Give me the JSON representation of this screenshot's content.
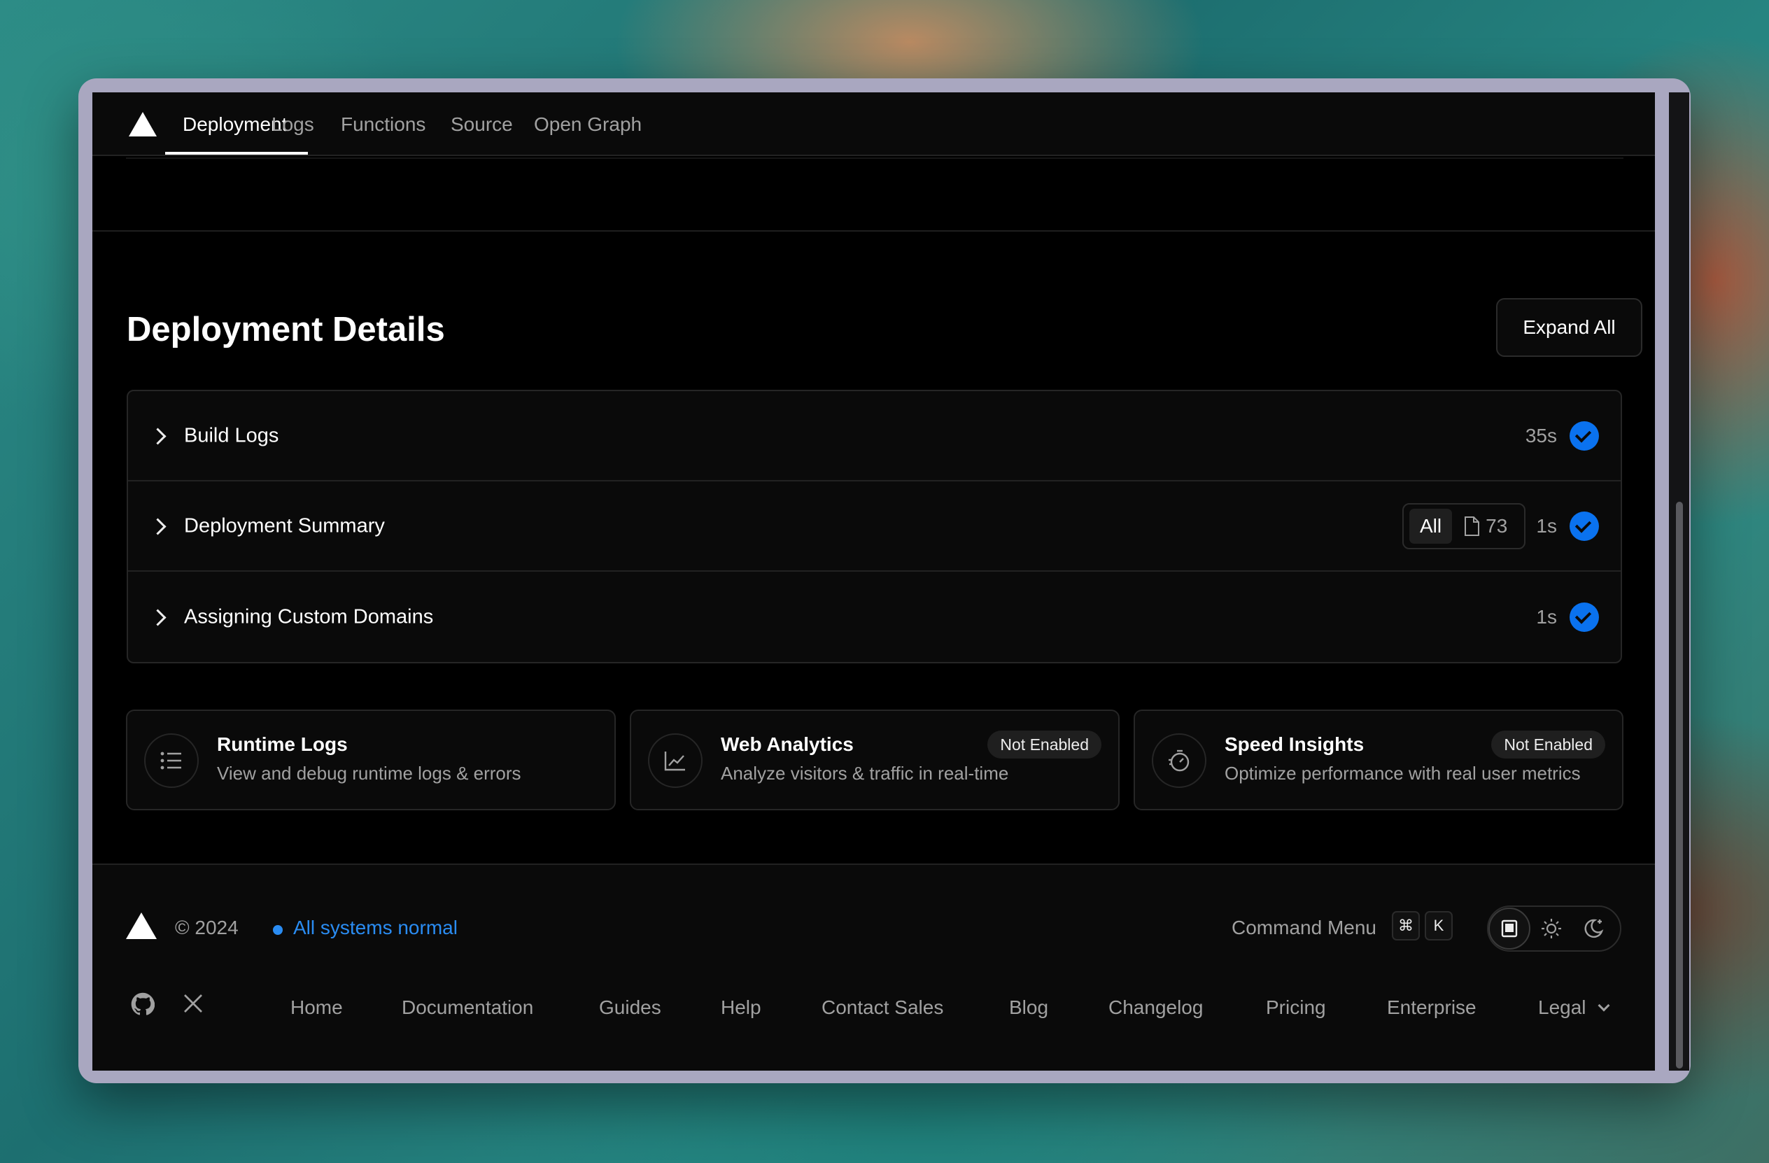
{
  "nav": {
    "tabs": [
      {
        "label": "Deployment",
        "active": true
      },
      {
        "label": "Logs"
      },
      {
        "label": "Functions"
      },
      {
        "label": "Source"
      },
      {
        "label": "Open Graph"
      }
    ]
  },
  "details": {
    "title": "Deployment Details",
    "expand_all_label": "Expand All",
    "rows": [
      {
        "label": "Build Logs",
        "duration": "35s",
        "status": "success"
      },
      {
        "label": "Deployment Summary",
        "filter_label": "All",
        "file_count": "73",
        "duration": "1s",
        "status": "success"
      },
      {
        "label": "Assigning Custom Domains",
        "duration": "1s",
        "status": "success"
      }
    ]
  },
  "cards": [
    {
      "title": "Runtime Logs",
      "subtitle": "View and debug runtime logs & errors",
      "icon": "list-icon"
    },
    {
      "title": "Web Analytics",
      "subtitle": "Analyze visitors & traffic in real-time",
      "badge": "Not Enabled",
      "icon": "chart-icon"
    },
    {
      "title": "Speed Insights",
      "subtitle": "Optimize performance with real user metrics",
      "badge": "Not Enabled",
      "icon": "stopwatch-icon"
    }
  ],
  "footer": {
    "copyright": "© 2024",
    "status": "All systems normal",
    "command_menu_label": "Command Menu",
    "shortcut_keys": [
      "⌘",
      "K"
    ],
    "links": [
      "Home",
      "Documentation",
      "Guides",
      "Help",
      "Contact Sales",
      "Blog",
      "Changelog",
      "Pricing",
      "Enterprise",
      "Legal"
    ]
  },
  "colors": {
    "accent": "#0a72ef",
    "status": "#2a8cf2",
    "background": "#000000"
  }
}
